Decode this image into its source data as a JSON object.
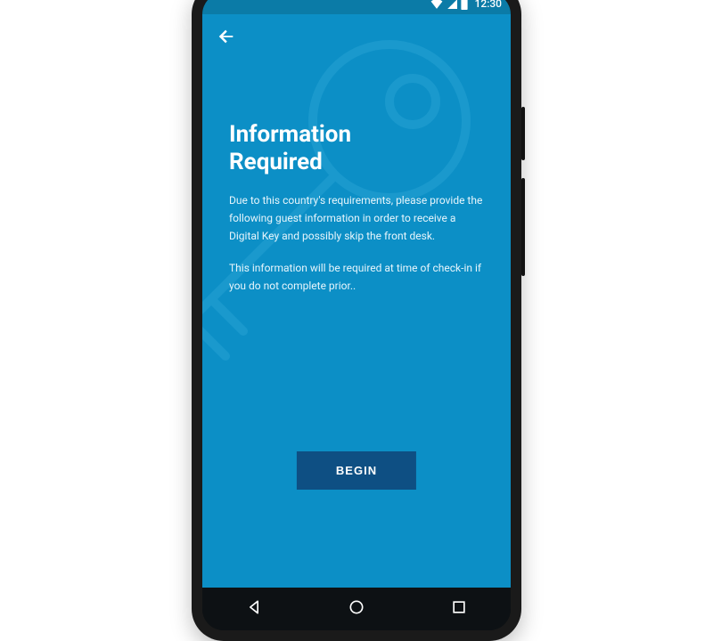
{
  "status": {
    "time": "12:30"
  },
  "page": {
    "title_line1": "Information",
    "title_line2": "Required",
    "para1": "Due to this country's requirements, please provide the following guest information in order to receive a Digital Key and possibly skip the front desk.",
    "para2": "This information will be required at time of check-in if you do not complete prior..",
    "cta": "BEGIN"
  }
}
